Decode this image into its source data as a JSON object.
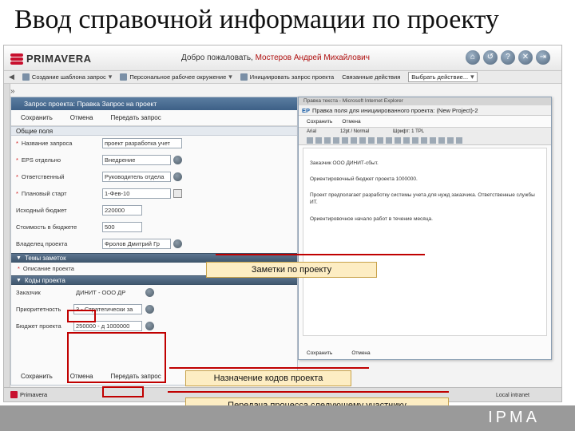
{
  "slide_title": "Ввод справочной информации по проекту",
  "header": {
    "brand": "PRIMAVERA",
    "welcome_prefix": "Добро пожаловать,",
    "user_name": "Мостеров Андрей Михайлович",
    "icons": [
      "home-icon",
      "back-icon",
      "help-icon",
      "tools-icon",
      "logout-icon"
    ]
  },
  "toolbar": {
    "items": [
      "Создание шаблона запрос",
      "Персональное рабочее окружение",
      "Инициировать запрос проекта",
      "Связанные действия",
      "Выбрать действие..."
    ]
  },
  "form": {
    "title": "Запрос проекта: Правка Запрос на проект",
    "actions": [
      "Сохранить",
      "Отмена",
      "Передать запрос"
    ],
    "section_general": "Общие поля",
    "fields": [
      {
        "label": "Название запроса",
        "required": true,
        "value": "проект разработка учет"
      },
      {
        "label": "EPS отдельно",
        "required": true,
        "value": "Внедрение"
      },
      {
        "label": "Ответственный",
        "required": true,
        "value": "Руководитель отдела"
      },
      {
        "label": "Плановый старт",
        "required": true,
        "value": "1-Фев-10"
      },
      {
        "label": "Исходный бюджет",
        "required": false,
        "value": "220000"
      },
      {
        "label": "Стоимость в бюджете",
        "required": false,
        "value": "500"
      },
      {
        "label": "Владелец проекта",
        "required": false,
        "value": "Фролов Дмитрий Гр"
      }
    ],
    "section_notes": "Темы заметок",
    "notes_item": "Описание проекта",
    "section_codes": "Коды проекта",
    "codes": [
      {
        "label": "Заказчик",
        "value": "ДИНИТ - ООО ДР"
      },
      {
        "label": "Приоритетность",
        "value": "3 - Стратегически за"
      },
      {
        "label": "Бюджет проекта",
        "value": "250000 - д 1000000"
      }
    ],
    "bottom_actions": [
      "Сохранить",
      "Отмена",
      "Передать запрос"
    ]
  },
  "notes_dialog": {
    "window_bar": "Правка текста - Microsoft Internet Explorer",
    "title_prefix": "EP",
    "title": "Правка поля для инициированного проекта: (New Project)-2",
    "actions": [
      "Сохранить",
      "Отмена"
    ],
    "format_labels": [
      "Arial",
      "12pt / Normal",
      "Шрифт: 1 TPL"
    ],
    "toolbar_icon_count": 18,
    "lines": [
      "Заказчик ООО ДИНИТ-сбыт.",
      "Ориентировочный бюджет проекта 1000000.",
      "Проект предполагает разработку системы учета для нужд заказчика. Ответственные службы ИТ.",
      "Ориентировочное начало работ в течение месяца."
    ],
    "bottom_actions": [
      "Сохранить",
      "Отмена"
    ]
  },
  "taskbar": {
    "brand": "Primavera",
    "status": "Local intranet"
  },
  "callouts": {
    "notes": "Заметки по проекту",
    "codes": "Назначение кодов проекта",
    "transfer": "Передача процесса следующему участнику"
  },
  "footer_brand": "IPMA",
  "colors": {
    "accent_red": "#c00000",
    "callout_fill": "#fdedc3",
    "panel_title": "#3d6087",
    "brand_red": "#c8102e"
  }
}
